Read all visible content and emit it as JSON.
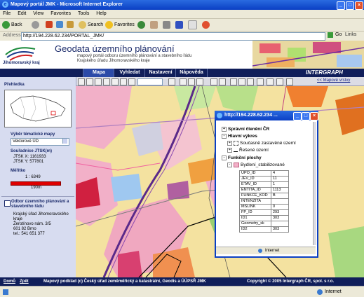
{
  "window": {
    "title": "Mapový portál JMK - Microsoft Internet Explorer",
    "min": "_",
    "max": "□",
    "close": "×"
  },
  "menu": [
    "File",
    "Edit",
    "View",
    "Favorites",
    "Tools",
    "Help"
  ],
  "toolbar": {
    "back": "Back",
    "search": "Search",
    "favorites": "Favorites"
  },
  "address": {
    "label": "Address",
    "url": "http://194.228.62.234/PORTAL_JMK/",
    "go": "Go",
    "links": "Links"
  },
  "header": {
    "logo_text": "Jihomoravský kraj",
    "title": "Geodata územního plánování",
    "subtitle1": "mapový portál odboru územního plánování a stavebního řádu",
    "subtitle2": "Krajského úřadu Jihomoravského kraje"
  },
  "tabs": [
    "Mapa",
    "Vyhledat",
    "Nastavení",
    "Nápověda"
  ],
  "active_tab": "Mapa",
  "brand": "INTERGRAPH",
  "map_layers_link": "<< Mapové vrstvy",
  "left": {
    "overview_label": "Přehledka",
    "theme_label": "Výběr tématické mapy",
    "theme_value": "Vektorové ÚD",
    "coords_label": "Souřadnice JTSK(m)",
    "jtsk_x": "JTSK X: 1161933",
    "jtsk_y": "JTSK Y: 577801",
    "scale_label": "Měřítko",
    "scale_value": "1 : 6349",
    "scale_bar_text": "190m",
    "odbor_title1": "Odbor územního plánování a",
    "odbor_title2": "stavebního řádu",
    "address_lines": [
      "Krajský úřad Jihomoravského",
      "kraje",
      "Žerotínovo nám. 3/5",
      "601 82 Brno",
      "tel.: 541 651 377"
    ]
  },
  "popup": {
    "title": "http://194.228.62.234 ...",
    "tree": [
      "Správní členění ČR",
      "Hlavní výkres",
      "Současně zastavěné území",
      "Řešené území",
      "Funkční plochy",
      "Bydlení_stabilizované"
    ],
    "attributes": [
      [
        "UPO_ID",
        "4"
      ],
      [
        "JEV_ID",
        "11"
      ],
      [
        "ETAV_ID",
        "1"
      ],
      [
        "ENTITA_ID",
        "1113"
      ],
      [
        "FUNKCE_KOD",
        "B"
      ],
      [
        "INTENZITA",
        ""
      ],
      [
        "MSLINK",
        "0"
      ],
      [
        "FP_ID",
        "293"
      ],
      [
        "ID1",
        "303"
      ],
      [
        "Geometry_sk",
        ""
      ],
      [
        "ID2",
        "303"
      ]
    ],
    "status": "Internet"
  },
  "footer": {
    "home": "Domů",
    "back": "Zpět",
    "copyright": "Mapový podklad (c) Český úřad zeměměřický a katastrální, Geodis a ÚÚPSŘ JMK",
    "copyright2": "Copyright © 2005 Intergraph ČR, spol. s r.o."
  },
  "status": {
    "zone": "Internet"
  }
}
